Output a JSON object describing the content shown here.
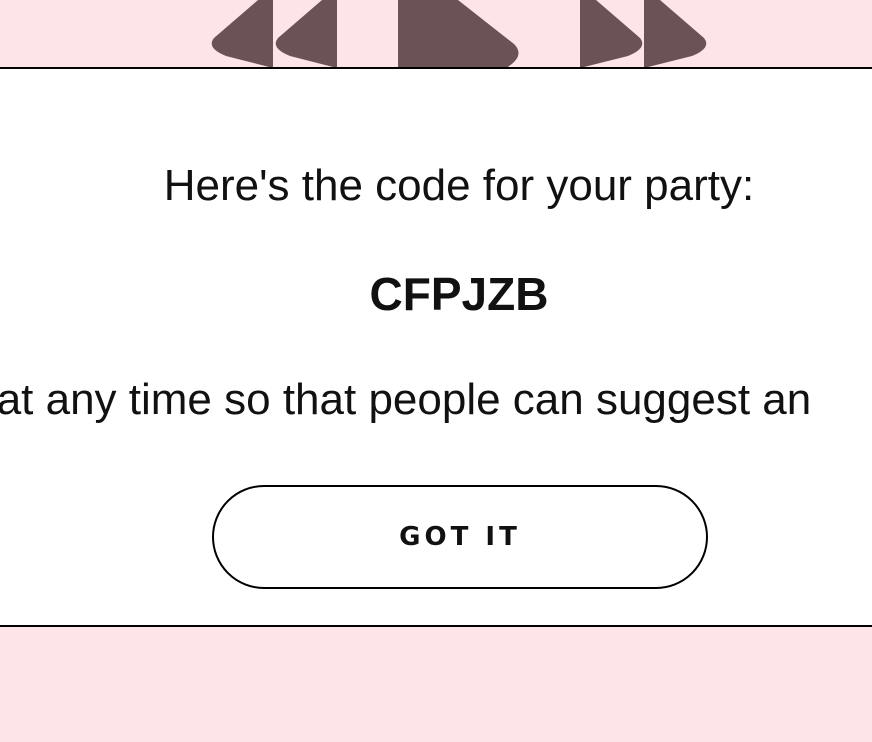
{
  "player_controls": {
    "icons": [
      "rewind-icon",
      "play-icon",
      "fast-forward-icon"
    ],
    "color": "#6b5257"
  },
  "modal": {
    "heading": "Here's the code for your party:",
    "party_code": "CFPJZB",
    "message": "e at any time so that people can suggest an",
    "button_label": "GOT IT"
  },
  "colors": {
    "background": "#fde4e8",
    "modal_background": "#ffffff",
    "text": "#111111"
  }
}
